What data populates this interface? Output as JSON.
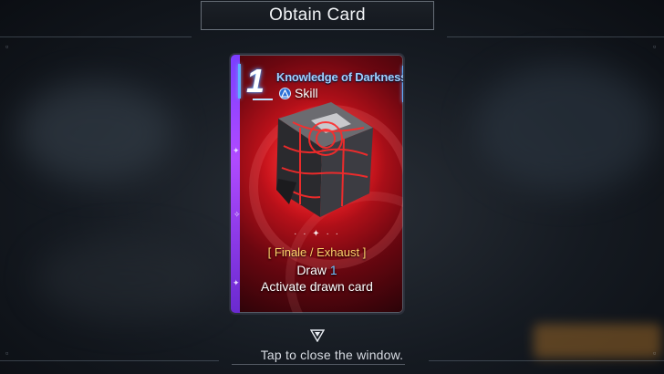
{
  "dialog": {
    "title": "Obtain Card"
  },
  "card": {
    "cost": "1",
    "name": "Knowledge of Darkness",
    "type": "Skill",
    "type_icon": "skill-triangle-icon",
    "keywords": "[ Finale / Exhaust ]",
    "effect": {
      "draw_label": "Draw",
      "draw_count": "1",
      "line2": "Activate drawn card"
    },
    "art": "dark-cube-art",
    "colors": {
      "frame_stripe": "#7b3dff",
      "cost_glow": "#5fb0ff",
      "name": "#9fd0ff",
      "keywords": "#ffd36b",
      "background": "#c3121b"
    }
  },
  "footer": {
    "prompt": "Tap to close the window.",
    "indicator_icon": "down-triangle-icon"
  }
}
